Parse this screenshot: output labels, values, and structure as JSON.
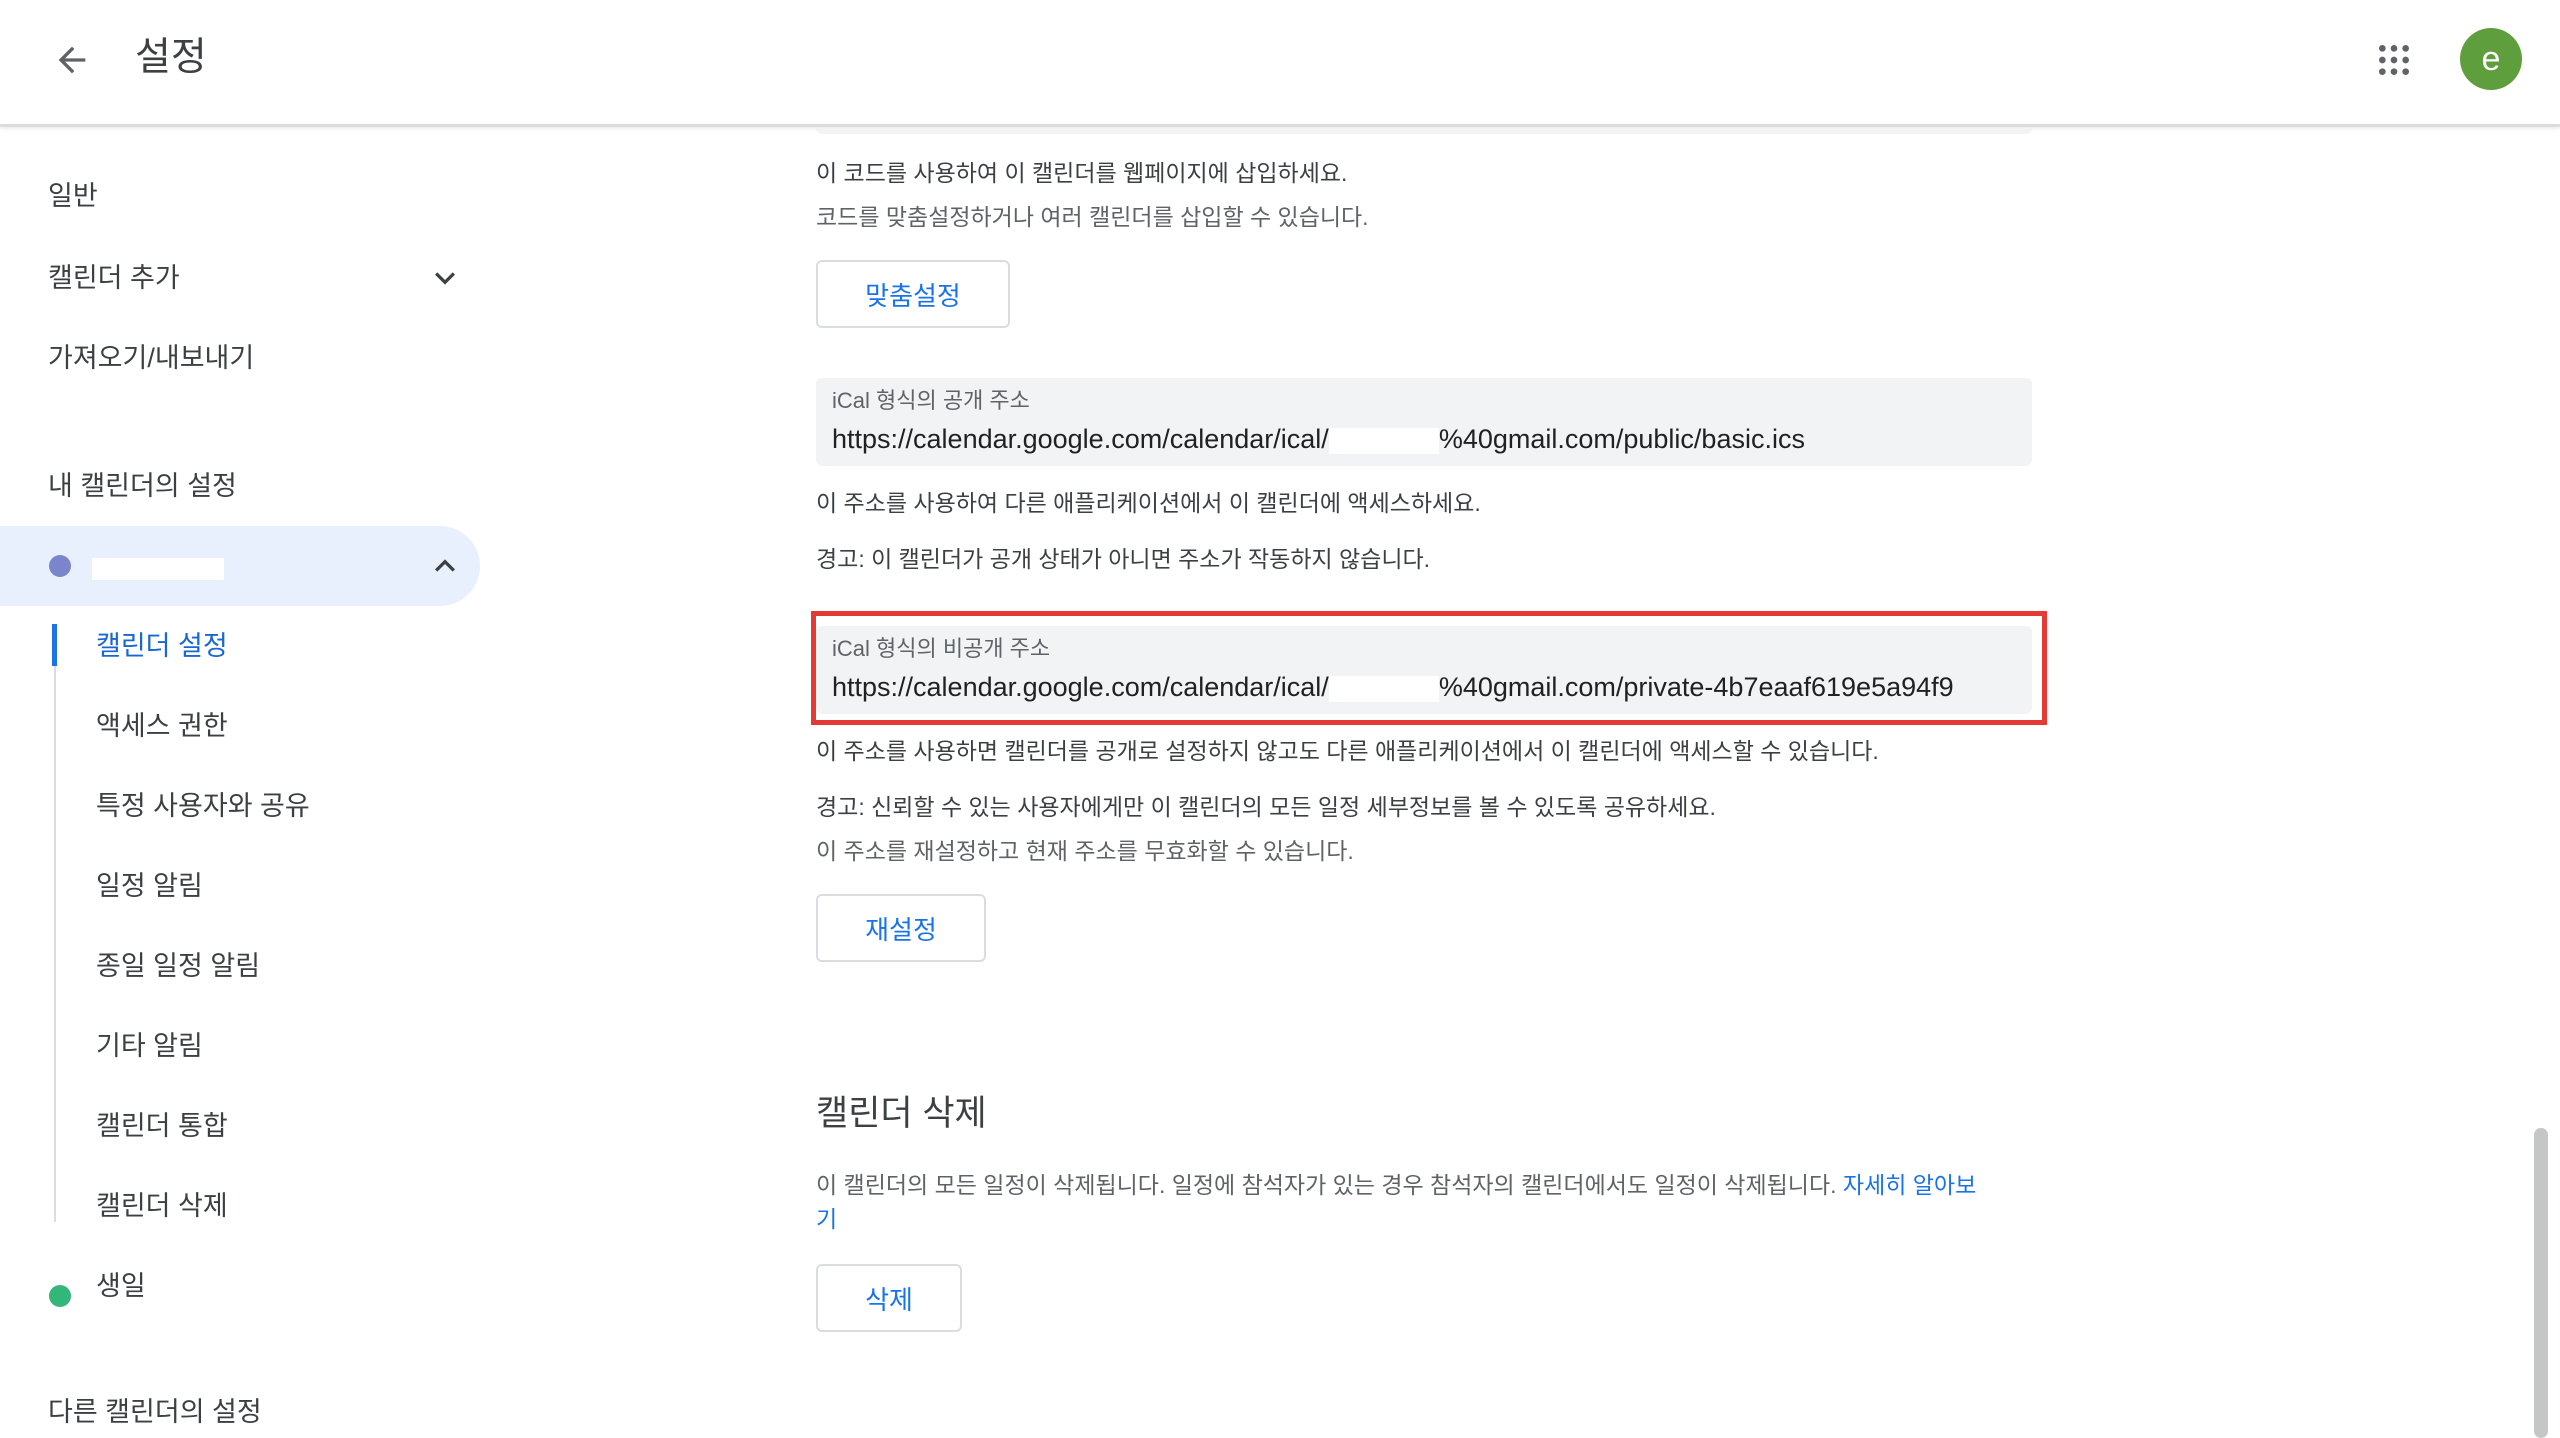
{
  "header": {
    "title": "설정",
    "avatar_letter": "e",
    "avatar_color": "#5f9e3d"
  },
  "sidebar": {
    "general": "일반",
    "add_calendar": "캘린더 추가",
    "import_export": "가져오기/내보내기",
    "my_calendars_heading": "내 캘린더의 설정",
    "my_calendar_color": "#7986cb",
    "sub_items": [
      "캘린더 설정",
      "액세스 권한",
      "특정 사용자와 공유",
      "일정 알림",
      "종일 일정 알림",
      "기타 알림",
      "캘린더 통합",
      "캘린더 삭제"
    ],
    "birthday": "생일",
    "birthday_color": "#33b679",
    "other_calendars_heading": "다른 캘린더의 설정"
  },
  "main": {
    "embed_desc": "이 코드를 사용하여 이 캘린더를 웹페이지에 삽입하세요.",
    "embed_sub": "코드를 맞춤설정하거나 여러 캘린더를 삽입할 수 있습니다.",
    "customize_button": "맞춤설정",
    "public_label": "iCal 형식의 공개 주소",
    "public_url_prefix": "https://calendar.google.com/calendar/ical/",
    "public_url_suffix": "%40gmail.com/public/basic.ics",
    "public_desc": "이 주소를 사용하여 다른 애플리케이션에서 이 캘린더에 액세스하세요.",
    "public_warning": "경고: 이 캘린더가 공개 상태가 아니면 주소가 작동하지 않습니다.",
    "private_label": "iCal 형식의 비공개 주소",
    "private_url_prefix": "https://calendar.google.com/calendar/ical/",
    "private_url_suffix": "%40gmail.com/private-4b7eaaf619e5a94f9",
    "private_desc": "이 주소를 사용하면 캘린더를 공개로 설정하지 않고도 다른 애플리케이션에서 이 캘린더에 액세스할 수 있습니다.",
    "private_warning": "경고: 신뢰할 수 있는 사용자에게만 이 캘린더의 모든 일정 세부정보를 볼 수 있도록 공유하세요.",
    "reset_sub": "이 주소를 재설정하고 현재 주소를 무효화할 수 있습니다.",
    "reset_button": "재설정",
    "delete_title": "캘린더 삭제",
    "delete_desc": "이 캘린더의 모든 일정이 삭제됩니다. 일정에 참석자가 있는 경우 참석자의 캘린더에서도 일정이 삭제됩니다.",
    "learn_more_link_a": "자세히 알아보",
    "learn_more_link_b": "기",
    "delete_button": "삭제"
  },
  "colors": {
    "accent": "#1a73e8",
    "highlight": "#e53935"
  }
}
